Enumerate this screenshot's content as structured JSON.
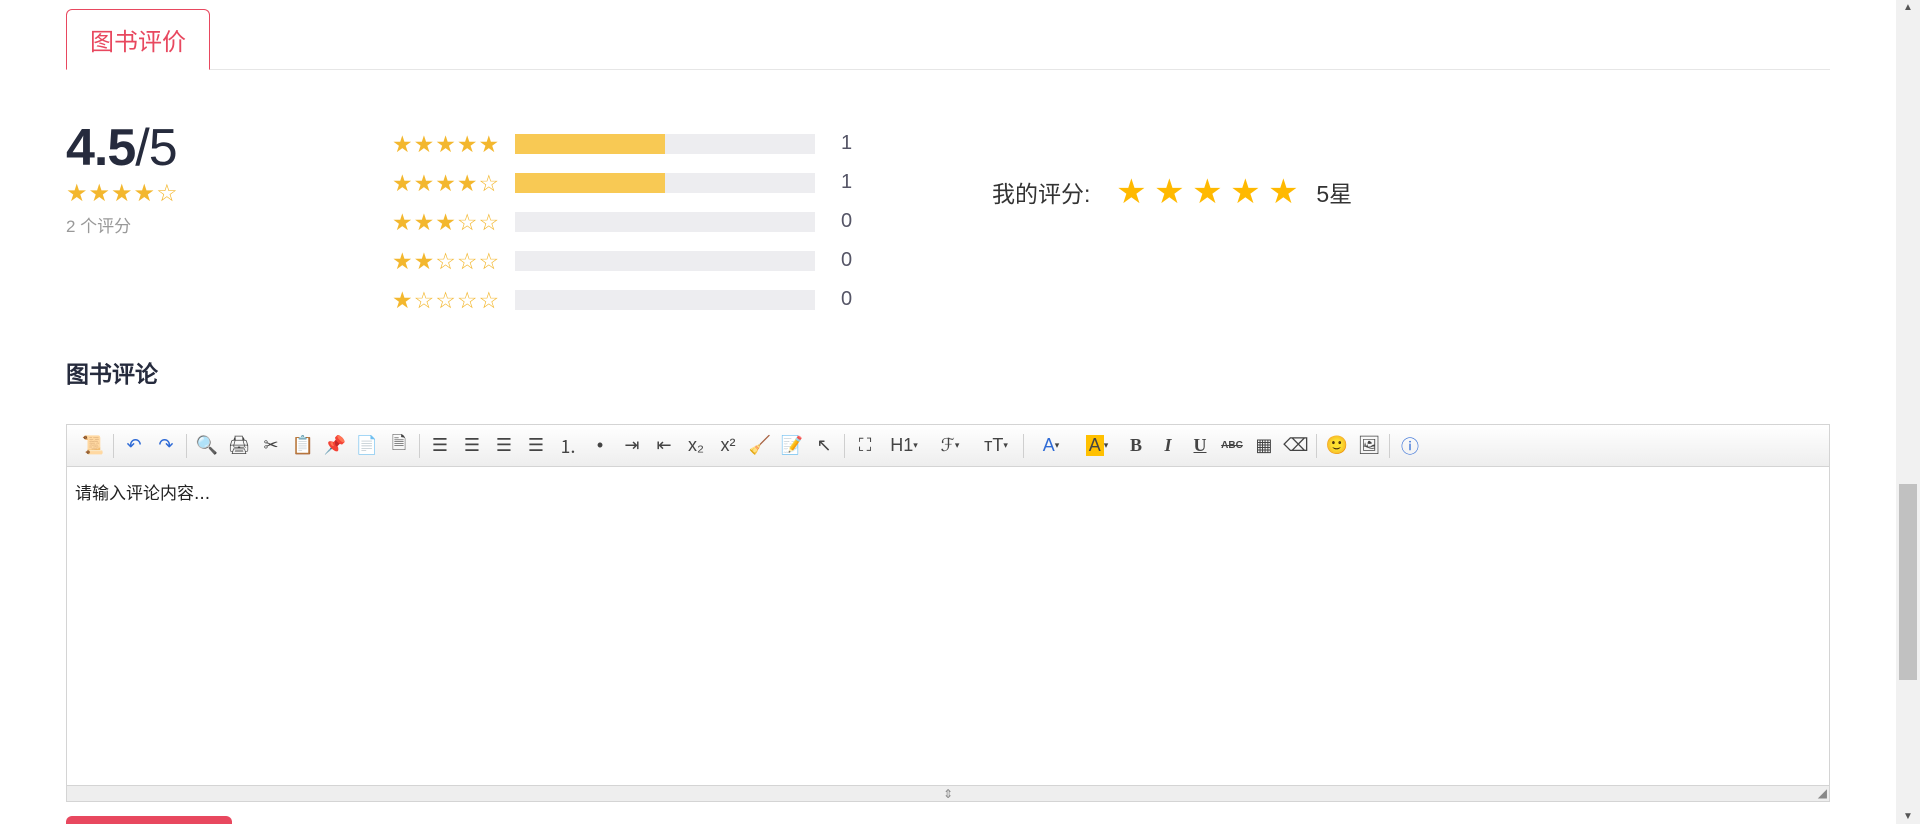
{
  "tabs": {
    "active_label": "图书评价"
  },
  "summary": {
    "score": "4.5",
    "out_of": "/5",
    "stars": "★★★★☆",
    "count_text": "2 个评分"
  },
  "distribution": [
    {
      "stars": "★★★★★",
      "fraction": 0.5,
      "count": "1"
    },
    {
      "stars": "★★★★☆",
      "fraction": 0.5,
      "count": "1"
    },
    {
      "stars": "★★★☆☆",
      "fraction": 0,
      "count": "0"
    },
    {
      "stars": "★★☆☆☆",
      "fraction": 0,
      "count": "0"
    },
    {
      "stars": "★☆☆☆☆",
      "fraction": 0,
      "count": "0"
    }
  ],
  "my_rating": {
    "label": "我的评分:",
    "value": "5星",
    "selected": 5
  },
  "comments": {
    "heading": "图书评论"
  },
  "editor": {
    "placeholder": "请输入评论内容...",
    "toolbar": {
      "heading": "H1",
      "font": "ℱ",
      "size": "тT",
      "font_color": "A",
      "bg_color": "A",
      "bold": "B",
      "italic": "I",
      "underline": "U",
      "strike": "ABC"
    }
  },
  "colors": {
    "accent": "#e8485f",
    "star": "#f3b72e",
    "bar": "#f8c954",
    "my_star": "#ffb900"
  }
}
